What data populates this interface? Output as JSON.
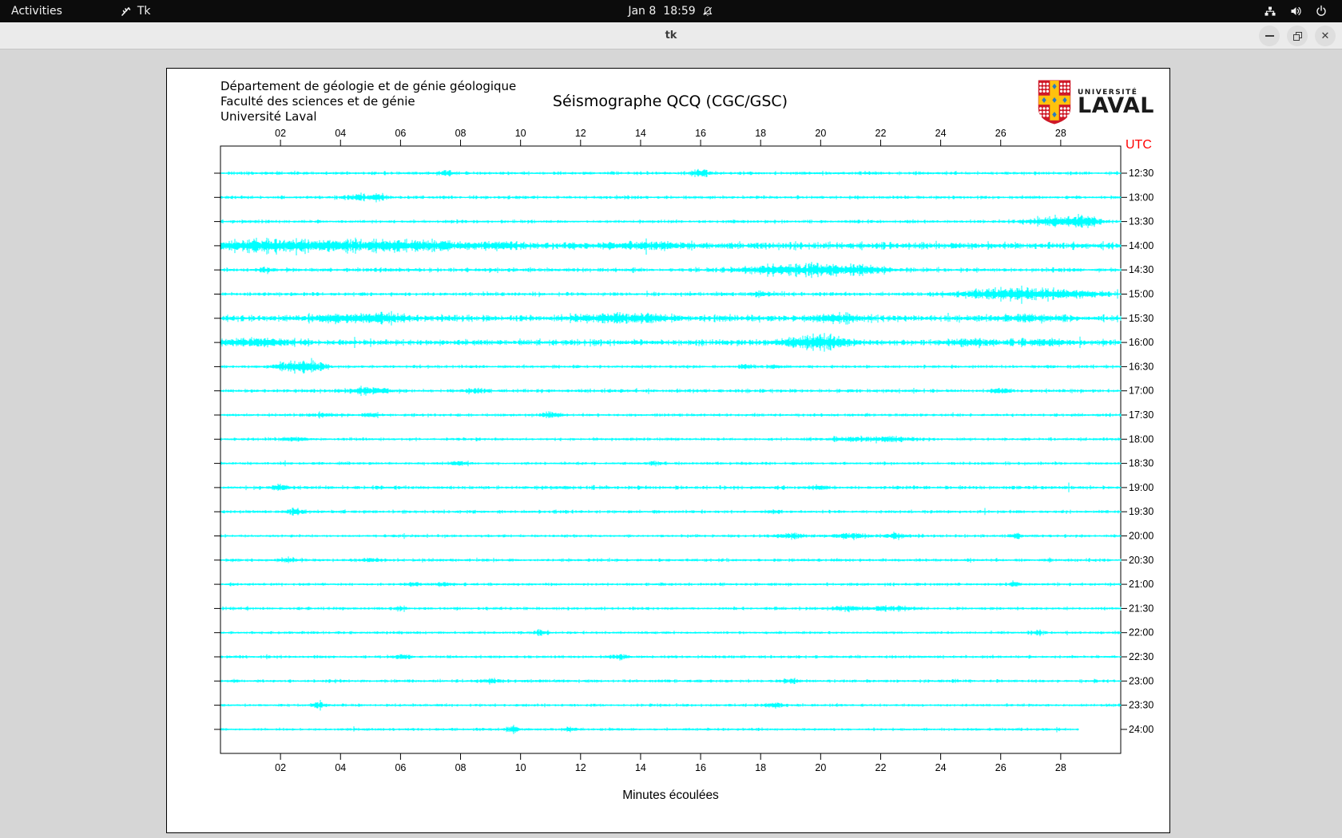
{
  "topbar": {
    "activities_label": "Activities",
    "app_label": "Tk",
    "clock_date": "Jan 8",
    "clock_time": "18:59"
  },
  "window": {
    "title": "tk"
  },
  "canvas_header": {
    "lines": [
      "Département de géologie et de génie géologique",
      "Faculté des sciences et de génie",
      "Université Laval"
    ]
  },
  "logo": {
    "line1": "UNIVERSITÉ",
    "line2": "LAVAL",
    "shield_red": "#cf1928",
    "shield_gold": "#ffc20e",
    "shield_blue": "#2a7bbf"
  },
  "chart_data": {
    "type": "line",
    "variant": "helicorder-seismogram",
    "title": "Séismographe QCQ (CGC/GSC)",
    "xlabel": "Minutes écoulées",
    "y_axis_right_label": "UTC",
    "utc_label_color": "#ff0000",
    "trace_color": "#00ffff",
    "x_axis": {
      "range_minutes": [
        0,
        30
      ],
      "tick_minutes": [
        2,
        4,
        6,
        8,
        10,
        12,
        14,
        16,
        18,
        20,
        22,
        24,
        26,
        28
      ],
      "tick_labels": [
        "02",
        "04",
        "06",
        "08",
        "10",
        "12",
        "14",
        "16",
        "18",
        "20",
        "22",
        "24",
        "26",
        "28"
      ]
    },
    "rows": [
      {
        "time": "12:30",
        "base": 1.6,
        "end": 30,
        "bursts": [
          [
            7.5,
            0.3,
            3
          ],
          [
            16,
            0.4,
            5
          ]
        ]
      },
      {
        "time": "13:00",
        "base": 1.6,
        "end": 30,
        "bursts": [
          [
            4.6,
            0.5,
            4
          ],
          [
            5.3,
            0.3,
            4
          ]
        ]
      },
      {
        "time": "13:30",
        "base": 1.5,
        "end": 30,
        "bursts": [
          [
            27.8,
            1.2,
            6
          ],
          [
            28.8,
            0.6,
            7
          ]
        ]
      },
      {
        "time": "14:00",
        "base": 3.2,
        "end": 30,
        "bursts": [
          [
            1,
            2,
            5
          ],
          [
            3,
            2,
            5
          ],
          [
            5.5,
            1.5,
            5
          ],
          [
            7,
            1,
            4
          ],
          [
            9,
            1.5,
            3
          ],
          [
            14,
            2,
            2.5
          ]
        ]
      },
      {
        "time": "14:30",
        "base": 2.0,
        "end": 30,
        "bursts": [
          [
            1.5,
            0.3,
            3
          ],
          [
            18.5,
            1.5,
            5
          ],
          [
            20,
            1.5,
            6
          ],
          [
            21.5,
            1,
            4
          ]
        ]
      },
      {
        "time": "15:00",
        "base": 1.8,
        "end": 30,
        "bursts": [
          [
            18,
            0.3,
            4
          ],
          [
            25.5,
            1.5,
            5
          ],
          [
            27,
            1.5,
            6
          ],
          [
            28.5,
            1,
            5
          ]
        ]
      },
      {
        "time": "15:30",
        "base": 3.0,
        "end": 30,
        "bursts": [
          [
            4,
            1.5,
            4
          ],
          [
            5.5,
            1,
            4
          ],
          [
            13,
            1.5,
            4
          ],
          [
            14.5,
            1,
            3
          ],
          [
            20.5,
            1,
            4
          ],
          [
            27,
            1.5,
            3
          ]
        ]
      },
      {
        "time": "16:00",
        "base": 2.8,
        "end": 30,
        "bursts": [
          [
            1,
            1.5,
            4
          ],
          [
            19.5,
            1,
            7
          ],
          [
            20.5,
            0.8,
            5
          ],
          [
            25,
            1,
            3
          ],
          [
            27.5,
            0.8,
            4
          ]
        ]
      },
      {
        "time": "16:30",
        "base": 1.5,
        "end": 30,
        "bursts": [
          [
            2.2,
            0.5,
            7
          ],
          [
            2.9,
            0.4,
            8
          ],
          [
            3.4,
            0.3,
            5
          ],
          [
            17.5,
            0.3,
            3
          ],
          [
            18.5,
            0.3,
            3
          ]
        ]
      },
      {
        "time": "17:00",
        "base": 1.7,
        "end": 30,
        "bursts": [
          [
            5,
            0.8,
            4
          ],
          [
            8.5,
            0.4,
            3
          ],
          [
            26,
            0.3,
            3
          ]
        ]
      },
      {
        "time": "17:30",
        "base": 1.5,
        "end": 30,
        "bursts": [
          [
            3.5,
            0.4,
            3
          ],
          [
            5,
            0.4,
            3
          ],
          [
            11,
            0.4,
            4
          ]
        ]
      },
      {
        "time": "18:00",
        "base": 1.4,
        "end": 30,
        "bursts": [
          [
            2.5,
            0.5,
            3
          ],
          [
            21,
            1,
            3
          ],
          [
            22.5,
            1,
            3.5
          ]
        ]
      },
      {
        "time": "18:30",
        "base": 1.4,
        "end": 30,
        "bursts": [
          [
            8,
            0.4,
            2.5
          ],
          [
            14.5,
            0.3,
            2.5
          ]
        ]
      },
      {
        "time": "19:00",
        "base": 1.7,
        "end": 30,
        "bursts": [
          [
            2,
            0.4,
            3
          ],
          [
            20,
            0.5,
            2.5
          ]
        ]
      },
      {
        "time": "19:30",
        "base": 1.5,
        "end": 30,
        "bursts": [
          [
            2.5,
            0.4,
            4
          ],
          [
            18.5,
            0.3,
            2.5
          ]
        ]
      },
      {
        "time": "20:00",
        "base": 1.4,
        "end": 30,
        "bursts": [
          [
            19,
            0.8,
            3
          ],
          [
            21,
            0.8,
            3
          ],
          [
            22.5,
            0.5,
            3
          ],
          [
            26.5,
            0.2,
            4
          ]
        ]
      },
      {
        "time": "20:30",
        "base": 1.5,
        "end": 30,
        "bursts": [
          [
            2.3,
            0.4,
            3
          ],
          [
            5,
            0.4,
            2.5
          ]
        ]
      },
      {
        "time": "21:00",
        "base": 1.4,
        "end": 30,
        "bursts": [
          [
            6.5,
            0.3,
            3
          ],
          [
            7.5,
            0.3,
            3
          ],
          [
            26.5,
            0.2,
            4
          ]
        ]
      },
      {
        "time": "21:30",
        "base": 1.4,
        "end": 30,
        "bursts": [
          [
            6,
            0.3,
            2.5
          ],
          [
            21,
            1,
            3
          ],
          [
            22.5,
            0.8,
            3
          ]
        ]
      },
      {
        "time": "22:00",
        "base": 1.3,
        "end": 30,
        "bursts": [
          [
            10.7,
            0.3,
            4
          ],
          [
            27.2,
            0.3,
            3
          ]
        ]
      },
      {
        "time": "22:30",
        "base": 1.4,
        "end": 30,
        "bursts": [
          [
            6,
            0.4,
            3
          ],
          [
            13.3,
            0.4,
            3
          ]
        ]
      },
      {
        "time": "23:00",
        "base": 1.5,
        "end": 30,
        "bursts": [
          [
            9,
            0.5,
            2.5
          ],
          [
            19,
            0.4,
            2.5
          ]
        ]
      },
      {
        "time": "23:30",
        "base": 1.4,
        "end": 30,
        "bursts": [
          [
            3.3,
            0.3,
            4
          ],
          [
            18.5,
            0.4,
            3
          ]
        ]
      },
      {
        "time": "24:00",
        "base": 1.3,
        "end": 28.6,
        "bursts": [
          [
            9.7,
            0.3,
            4
          ],
          [
            11.7,
            0.3,
            3.5
          ]
        ]
      }
    ]
  }
}
